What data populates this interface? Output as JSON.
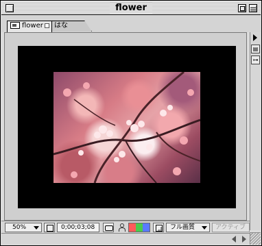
{
  "window": {
    "title": "flower"
  },
  "tabs": [
    {
      "label": "flower"
    },
    {
      "label": "はな"
    }
  ],
  "toolbar": {
    "zoom": "50%",
    "timecode": "0;00;03;08",
    "resolution": "フル画質",
    "view": "アクティブ"
  },
  "icons": {
    "close": "close-box-icon",
    "zoom": "zoom-box-icon",
    "collapse": "collapse-box-icon",
    "composition": "composition-icon",
    "lock": "lock-icon",
    "panel_menu": "triangle-right-icon",
    "grid": "grid-icon",
    "flowchart": "flowchart-icon",
    "safe_area": "safe-area-icon",
    "snapshot": "camera-icon",
    "show_snapshot": "person-icon",
    "channels": "rgb-channels-icon",
    "region": "region-of-interest-icon",
    "scroll_left": "scroll-left-icon",
    "scroll_right": "scroll-right-icon",
    "grow": "resize-grip-icon"
  }
}
